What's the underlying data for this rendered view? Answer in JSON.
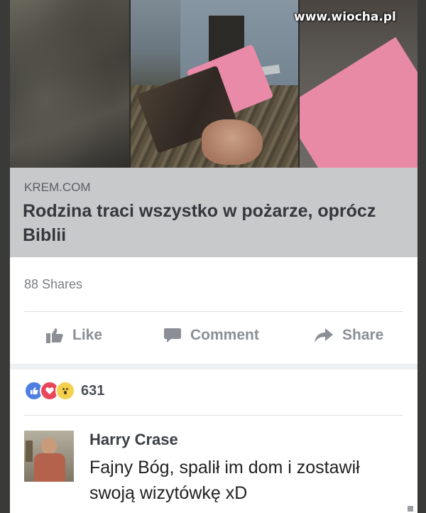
{
  "watermark": "www.wiocha.pl",
  "link_preview": {
    "domain": "KREM.COM",
    "title": "Rodzina traci wszystko w pożarze, oprócz Biblii"
  },
  "post_stats": {
    "shares": "88 Shares",
    "reaction_count": "631",
    "reactions": [
      "like-icon",
      "love-icon",
      "wow-icon"
    ]
  },
  "actions": {
    "like": "Like",
    "comment": "Comment",
    "share": "Share"
  },
  "comment": {
    "author": "Harry Crase",
    "text": "Fajny Bóg, spalił im dom i zostawił swoją wizytówkę xD"
  },
  "colors": {
    "action_gray": "#8b8f95",
    "caption_bg": "#c8c9cb",
    "like_blue": "#4f7fe0",
    "love_red": "#e8475a",
    "wow_yellow": "#f4d04d"
  }
}
